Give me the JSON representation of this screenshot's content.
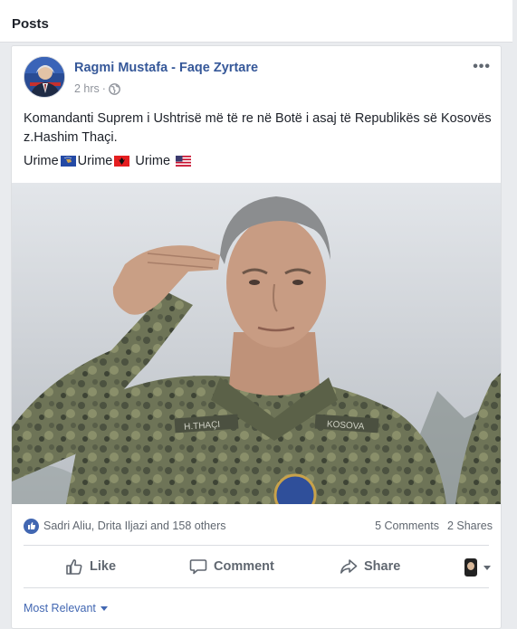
{
  "section": {
    "title": "Posts"
  },
  "post": {
    "author": "Ragmi Mustafa - Faqe Zyrtare",
    "time": "2 hrs",
    "visibility_icon": "globe-icon",
    "more_icon": "more-options-icon",
    "more_label": "•••",
    "text_line1": "Komandanti Suprem i Ushtrisë më të re në Botë i asaj të Republikës së Kosovës z.Hashim Thaçi.",
    "text_line2": {
      "part1": "Urime",
      "part2": "Urime",
      "part3": " Urime "
    },
    "flags": [
      "kosovo-flag",
      "albania-flag",
      "usa-flag"
    ]
  },
  "reactions": {
    "icon": "like-reaction-icon",
    "summary": "Sadri Aliu, Drita Iljazi and 158 others",
    "comments": "5 Comments",
    "shares": "2 Shares"
  },
  "actions": {
    "like": "Like",
    "comment": "Comment",
    "share": "Share"
  },
  "comments_filter": {
    "label": "Most Relevant"
  },
  "colors": {
    "link_blue": "#365899",
    "fb_blue": "#4267b2",
    "meta_grey": "#90949c",
    "action_grey": "#606770",
    "background": "#e9ebee"
  }
}
